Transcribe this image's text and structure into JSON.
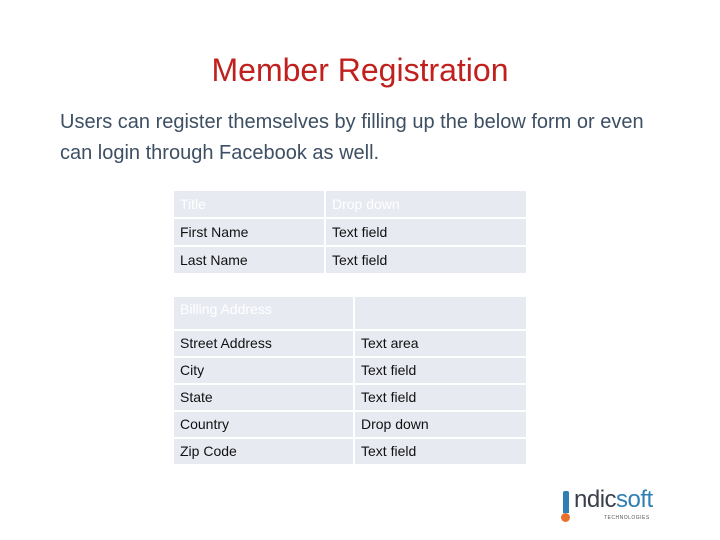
{
  "slide": {
    "title": "Member Registration",
    "intro": "Users can register themselves by filling up the below form or even can login through Facebook as well."
  },
  "colors": {
    "title": "#c0201e",
    "body_text": "#3d4f63",
    "table_cell_bg": "#e8eaf2",
    "table_header_text": "#ffffff"
  },
  "personal_table": {
    "header": [
      "Title",
      "Drop down"
    ],
    "rows": [
      [
        "First Name",
        "Text field"
      ],
      [
        "Last Name",
        "Text field"
      ]
    ]
  },
  "billing_table": {
    "header": [
      "Billing Address",
      ""
    ],
    "rows": [
      [
        "Street Address",
        "Text area"
      ],
      [
        "City",
        "Text field"
      ],
      [
        "State",
        "Text field"
      ],
      [
        "Country",
        "Drop down"
      ],
      [
        "Zip Code",
        "Text field"
      ]
    ]
  },
  "logo": {
    "name_prefix": "ndic",
    "name_suffix": "soft",
    "tagline": "TECHNOLOGIES"
  }
}
